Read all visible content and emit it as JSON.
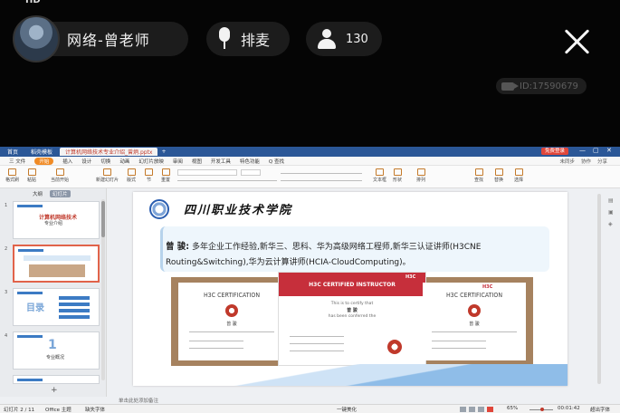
{
  "live": {
    "status_bar": {
      "left": "HD",
      "right": ""
    },
    "host_name": "网络-曾老师",
    "mic_label": "排麦",
    "viewer_count": "130",
    "room_id": "ID:17590679"
  },
  "wps": {
    "title_tabs": [
      "首页",
      "稻壳模板",
      "计算机网络技术专业介绍_曾炳.pptx"
    ],
    "title_right_button": "免费登录",
    "window_controls": [
      "—",
      "▢",
      "✕"
    ],
    "menu": [
      "三 文件",
      "开始",
      "插入",
      "设计",
      "切换",
      "动画",
      "幻灯片放映",
      "审阅",
      "视图",
      "开发工具",
      "特色功能",
      "Q 查找"
    ],
    "menu_right": [
      "未同步",
      "协作",
      "分享"
    ],
    "ribbon_labels": [
      "格式刷",
      "粘贴",
      "当前开始",
      "新建幻灯片",
      "版式",
      "节",
      "重置",
      "文本框",
      "形状",
      "排列",
      "查找",
      "替换",
      "选择"
    ],
    "sidebar_tabs": [
      "大纲",
      "幻灯片"
    ],
    "thumbnails": [
      {
        "num": "1",
        "title": "计算机网络技术",
        "subtitle": "专业介绍"
      },
      {
        "num": "2",
        "title": "",
        "subtitle": ""
      },
      {
        "num": "3",
        "title": "目录",
        "subtitle": ""
      },
      {
        "num": "4",
        "title": "1",
        "subtitle": "专业概况"
      }
    ],
    "add_slide": "+",
    "notes_placeholder": "单击此处添加备注",
    "status_left": "幻灯片 2 / 11",
    "status_theme": "Office 主题",
    "status_font": "缺失字体",
    "status_beautify": "一键美化",
    "status_zoom": "65%",
    "status_right": "00:01:42",
    "status_record": "超出字体"
  },
  "slide": {
    "school_name": "四川职业技术学院",
    "intro_name": "曾 骏:",
    "intro_text": "多年企业工作经验,新华三、思科、华为高级网络工程师,新华三认证讲师(H3CNE Routing&Switching),华为云计算讲师(HCIA-CloudComputing)。",
    "cert_left_title": "H3C CERTIFICATION",
    "cert_mid_title": "H3C CERTIFIED INSTRUCTOR",
    "cert_mid_line1": "This is to certify that",
    "cert_mid_line2": "has been conferred the",
    "cert_right_title": "H3C CERTIFICATION",
    "cert_name": "曾 骏",
    "h3c_brand": "H3C"
  }
}
